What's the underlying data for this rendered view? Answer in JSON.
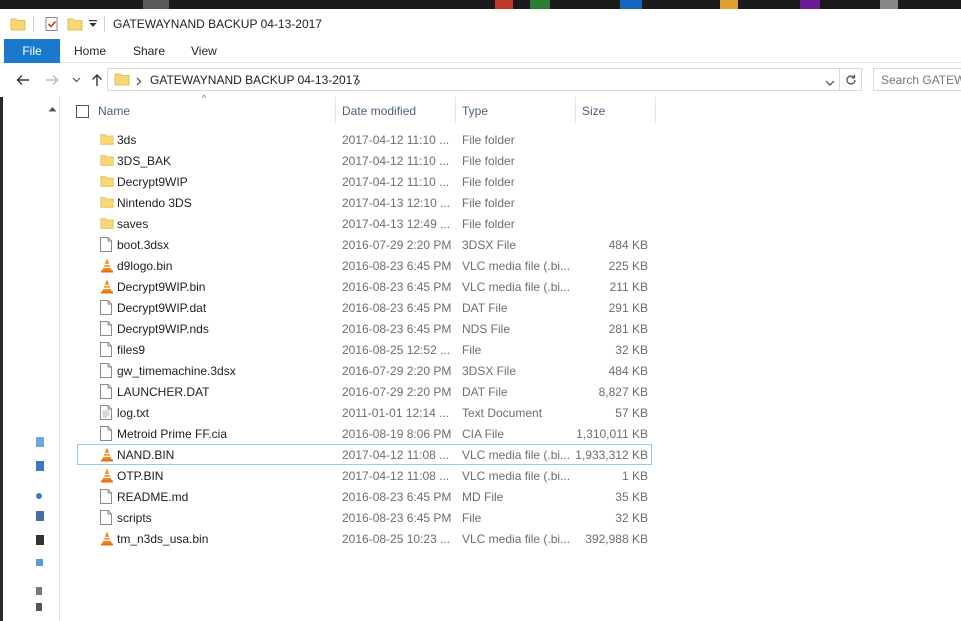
{
  "window": {
    "title": "GATEWAYNAND BACKUP 04-13-2017"
  },
  "ribbon": {
    "tabs": [
      "File",
      "Home",
      "Share",
      "View"
    ]
  },
  "address": {
    "path": "GATEWAYNAND BACKUP 04-13-2017",
    "search_placeholder": "Search GATEWA..."
  },
  "columns": {
    "name": "Name",
    "date": "Date modified",
    "type": "Type",
    "size": "Size"
  },
  "colors": {
    "accent": "#1979ca",
    "folder": "#f8d775",
    "header_text": "#4c607a",
    "focus_border": "#99c9ef"
  },
  "files": [
    {
      "name": "3ds",
      "date": "2017-04-12 11:10 ...",
      "type": "File folder",
      "size": "",
      "icon": "folder-icon"
    },
    {
      "name": "3DS_BAK",
      "date": "2017-04-12 11:10 ...",
      "type": "File folder",
      "size": "",
      "icon": "folder-icon"
    },
    {
      "name": "Decrypt9WIP",
      "date": "2017-04-12 11:10 ...",
      "type": "File folder",
      "size": "",
      "icon": "folder-icon"
    },
    {
      "name": "Nintendo 3DS",
      "date": "2017-04-13 12:10 ...",
      "type": "File folder",
      "size": "",
      "icon": "folder-icon"
    },
    {
      "name": "saves",
      "date": "2017-04-13 12:49 ...",
      "type": "File folder",
      "size": "",
      "icon": "folder-icon"
    },
    {
      "name": "boot.3dsx",
      "date": "2016-07-29 2:20 PM",
      "type": "3DSX File",
      "size": "484 KB",
      "icon": "file-icon"
    },
    {
      "name": "d9logo.bin",
      "date": "2016-08-23 6:45 PM",
      "type": "VLC media file (.bi...",
      "size": "225 KB",
      "icon": "vlc-icon"
    },
    {
      "name": "Decrypt9WIP.bin",
      "date": "2016-08-23 6:45 PM",
      "type": "VLC media file (.bi...",
      "size": "211 KB",
      "icon": "vlc-icon"
    },
    {
      "name": "Decrypt9WIP.dat",
      "date": "2016-08-23 6:45 PM",
      "type": "DAT File",
      "size": "291 KB",
      "icon": "file-icon"
    },
    {
      "name": "Decrypt9WIP.nds",
      "date": "2016-08-23 6:45 PM",
      "type": "NDS File",
      "size": "281 KB",
      "icon": "file-icon"
    },
    {
      "name": "files9",
      "date": "2016-08-25 12:52 ...",
      "type": "File",
      "size": "32 KB",
      "icon": "file-icon"
    },
    {
      "name": "gw_timemachine.3dsx",
      "date": "2016-07-29 2:20 PM",
      "type": "3DSX File",
      "size": "484 KB",
      "icon": "file-icon"
    },
    {
      "name": "LAUNCHER.DAT",
      "date": "2016-07-29 2:20 PM",
      "type": "DAT File",
      "size": "8,827 KB",
      "icon": "file-icon"
    },
    {
      "name": "log.txt",
      "date": "2011-01-01 12:14 ...",
      "type": "Text Document",
      "size": "57 KB",
      "icon": "text-file-icon"
    },
    {
      "name": "Metroid Prime FF.cia",
      "date": "2016-08-19 8:06 PM",
      "type": "CIA File",
      "size": "1,310,011 KB",
      "icon": "file-icon"
    },
    {
      "name": "NAND.BIN",
      "date": "2017-04-12 11:08 ...",
      "type": "VLC media file (.bi...",
      "size": "1,933,312 KB",
      "icon": "vlc-icon",
      "focused": true
    },
    {
      "name": "OTP.BIN",
      "date": "2017-04-12 11:08 ...",
      "type": "VLC media file (.bi...",
      "size": "1 KB",
      "icon": "vlc-icon"
    },
    {
      "name": "README.md",
      "date": "2016-08-23 6:45 PM",
      "type": "MD File",
      "size": "35 KB",
      "icon": "file-icon"
    },
    {
      "name": "scripts",
      "date": "2016-08-23 6:45 PM",
      "type": "File",
      "size": "32 KB",
      "icon": "file-icon"
    },
    {
      "name": "tm_n3ds_usa.bin",
      "date": "2016-08-25 10:23 ...",
      "type": "VLC media file (.bi...",
      "size": "392,988 KB",
      "icon": "vlc-icon"
    }
  ]
}
